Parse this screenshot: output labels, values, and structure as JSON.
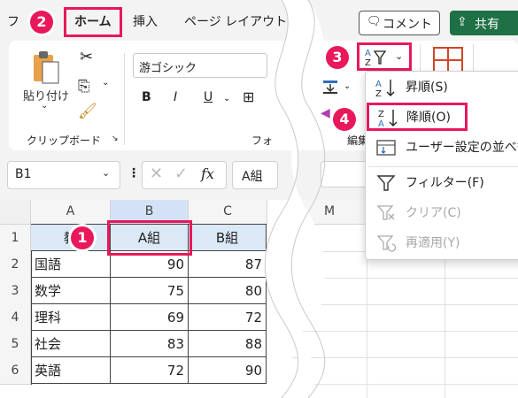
{
  "tabs": {
    "file_partial": "フ",
    "home": "ホーム",
    "insert": "挿入",
    "page_layout": "ページ レイアウト"
  },
  "top_buttons": {
    "comment": "コメント",
    "share": "共有"
  },
  "ribbon": {
    "paste_label": "貼り付け",
    "clipboard_group": "クリップボード",
    "font_name": "游ゴシック",
    "bold": "B",
    "italic": "I",
    "underline": "U",
    "font_group_partial": "フォ",
    "edit_group_partial": "編集"
  },
  "formula_bar": {
    "name_box": "B1",
    "formula_value": "A組",
    "fx": "fx"
  },
  "sheet": {
    "columns": [
      "A",
      "B",
      "C",
      "M"
    ],
    "rows": [
      "1",
      "2",
      "3",
      "4",
      "5",
      "6"
    ],
    "header_row": [
      "教",
      "A組",
      "B組"
    ],
    "data": [
      {
        "subject": "国語",
        "a": "90",
        "b": "87"
      },
      {
        "subject": "数学",
        "a": "75",
        "b": "80"
      },
      {
        "subject": "理科",
        "a": "69",
        "b": "72"
      },
      {
        "subject": "社会",
        "a": "83",
        "b": "88"
      },
      {
        "subject": "英語",
        "a": "72",
        "b": "90"
      }
    ]
  },
  "sort_menu": {
    "items": [
      {
        "label": "昇順(S)",
        "icon": "sort-ascending-icon",
        "enabled": true
      },
      {
        "label": "降順(O)",
        "icon": "sort-descending-icon",
        "enabled": true
      },
      {
        "label": "ユーザー設定の並べ替",
        "icon": "custom-sort-icon",
        "enabled": true
      },
      {
        "label": "フィルター(F)",
        "icon": "filter-icon",
        "enabled": true
      },
      {
        "label": "クリア(C)",
        "icon": "clear-filter-icon",
        "enabled": false
      },
      {
        "label": "再適用(Y)",
        "icon": "reapply-icon",
        "enabled": false
      }
    ]
  },
  "callouts": [
    "1",
    "2",
    "3",
    "4"
  ],
  "colors": {
    "accent": "#e8185b",
    "share_green": "#1e7145",
    "header_fill": "#dbe9f7"
  }
}
